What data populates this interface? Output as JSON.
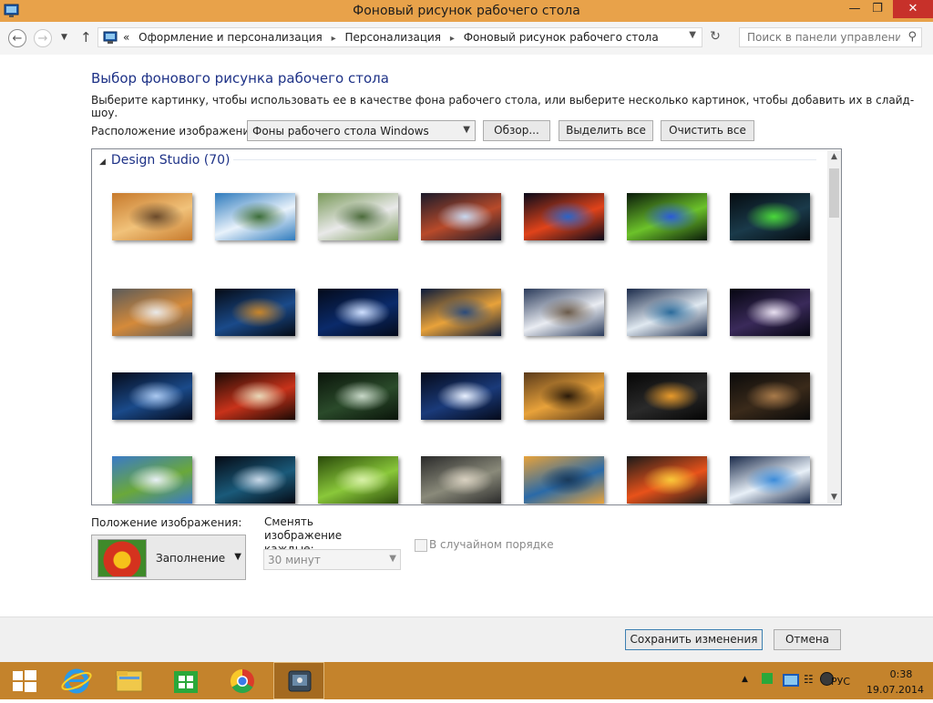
{
  "window": {
    "title": "Фоновый рисунок рабочего стола"
  },
  "address": {
    "overflow": "«",
    "crumbs": [
      "Оформление и персонализация",
      "Персонализация",
      "Фоновый рисунок рабочего стола"
    ]
  },
  "search": {
    "placeholder": "Поиск в панели управления"
  },
  "page": {
    "heading": "Выбор фонового рисунка рабочего стола",
    "description": "Выберите картинку, чтобы использовать ее в качестве фона рабочего стола, или выберите несколько картинок, чтобы добавить их в слайд-шоу.",
    "location_label": "Расположение изображения:",
    "location_value": "Фоны рабочего стола Windows",
    "browse_label": "Обзор...",
    "select_all_label": "Выделить все",
    "clear_all_label": "Очистить все"
  },
  "gallery": {
    "group_name": "Design Studio (70)",
    "thumbnails": [
      {
        "name": "kitten",
        "colors": [
          "#c77a2c",
          "#f1c27a",
          "#6b4a2a"
        ]
      },
      {
        "name": "sea-coast",
        "colors": [
          "#2f7bbd",
          "#e8f2fb",
          "#3b6d3a"
        ]
      },
      {
        "name": "white-tigers",
        "colors": [
          "#7a9a5a",
          "#e9e9e9",
          "#4b6b3a"
        ]
      },
      {
        "name": "space-planet",
        "colors": [
          "#1a1a2a",
          "#b84a2a",
          "#c7d7ef"
        ]
      },
      {
        "name": "apple-fire",
        "colors": [
          "#0a0a1a",
          "#e0431a",
          "#2a64c8"
        ]
      },
      {
        "name": "green-tunnel",
        "colors": [
          "#0a1a0a",
          "#6cc22a",
          "#2a5ad8"
        ]
      },
      {
        "name": "green-box",
        "colors": [
          "#050b10",
          "#1a3a4a",
          "#4ad83a"
        ]
      },
      {
        "name": "tiger-cub",
        "colors": [
          "#5a5a5a",
          "#d58a3a",
          "#e9e9e9"
        ]
      },
      {
        "name": "earth-globe",
        "colors": [
          "#050a14",
          "#1a4a8a",
          "#c8852a"
        ]
      },
      {
        "name": "blue-moon",
        "colors": [
          "#040a1a",
          "#0a2a6a",
          "#cfe0ff"
        ]
      },
      {
        "name": "mountain-lights",
        "colors": [
          "#0a1a3a",
          "#e8a23a",
          "#2a4a7a"
        ]
      },
      {
        "name": "snow-mountains",
        "colors": [
          "#2a3a5a",
          "#e9ecf2",
          "#6a5a4a"
        ]
      },
      {
        "name": "mountain-lake",
        "colors": [
          "#1a2a4a",
          "#dfe8f0",
          "#2a6a9a"
        ]
      },
      {
        "name": "nebula",
        "colors": [
          "#050510",
          "#3a2a5a",
          "#e8e0f0"
        ]
      },
      {
        "name": "blue-robot",
        "colors": [
          "#050a1a",
          "#1a4a8a",
          "#aac8f0"
        ]
      },
      {
        "name": "red-forest",
        "colors": [
          "#1a0a05",
          "#c8321a",
          "#e8d8b8"
        ]
      },
      {
        "name": "dark-road",
        "colors": [
          "#0a140a",
          "#2a4a2a",
          "#c8d8c8"
        ]
      },
      {
        "name": "blue-orb",
        "colors": [
          "#050a1a",
          "#1a3a7a",
          "#e8f0ff"
        ]
      },
      {
        "name": "bird-branch",
        "colors": [
          "#5a3a1a",
          "#e8a23a",
          "#2a1a0a"
        ]
      },
      {
        "name": "wine-glass",
        "colors": [
          "#050505",
          "#2a2a2a",
          "#e89a2a"
        ]
      },
      {
        "name": "dark-woods",
        "colors": [
          "#0a0a0a",
          "#3a2a1a",
          "#a87a4a"
        ]
      },
      {
        "name": "green-hills",
        "colors": [
          "#3a7ac8",
          "#6aa83a",
          "#e8f0f8"
        ]
      },
      {
        "name": "space-orbs",
        "colors": [
          "#050a14",
          "#1a5a7a",
          "#c8d8e8"
        ]
      },
      {
        "name": "green-drops",
        "colors": [
          "#2a4a0a",
          "#8ac83a",
          "#d8f0a8"
        ]
      },
      {
        "name": "girl-rails",
        "colors": [
          "#2a2a2a",
          "#8a8a7a",
          "#d8d0c0"
        ]
      },
      {
        "name": "sunset-sea",
        "colors": [
          "#e8a23a",
          "#2a6aa8",
          "#1a3a5a"
        ]
      },
      {
        "name": "fire-car",
        "colors": [
          "#1a1a1a",
          "#e8521a",
          "#f8c83a"
        ]
      },
      {
        "name": "ice-lake",
        "colors": [
          "#1a2a4a",
          "#e8f0f8",
          "#3a8ad8"
        ]
      }
    ]
  },
  "settings": {
    "position_label": "Положение изображения:",
    "position_value": "Заполнение",
    "change_label": "Сменять изображение каждые:",
    "change_value": "30 минут",
    "shuffle_label": "В случайном порядке"
  },
  "footer": {
    "save_label": "Сохранить изменения",
    "cancel_label": "Отмена"
  },
  "taskbar": {
    "apps": [
      "internet-explorer",
      "file-explorer",
      "store",
      "chrome",
      "control-panel"
    ],
    "language": "РУС",
    "time": "0:38",
    "date": "19.07.2014"
  }
}
